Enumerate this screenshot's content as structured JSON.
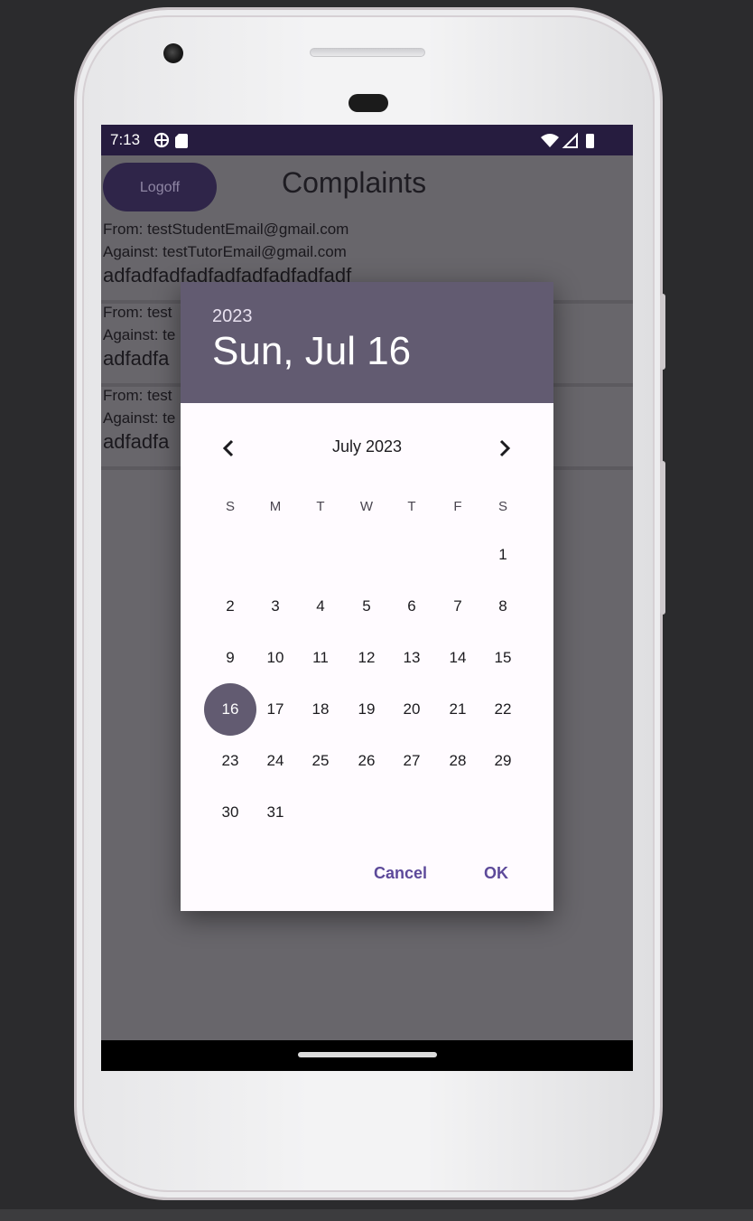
{
  "status_bar": {
    "time": "7:13"
  },
  "app": {
    "logoff_label": "Logoff",
    "title": "Complaints"
  },
  "complaints": [
    {
      "from": "From: testStudentEmail@gmail.com",
      "against": "Against: testTutorEmail@gmail.com",
      "body": "adfadfadfadfadfadfadfadfadf"
    },
    {
      "from": "From: test",
      "against": "Against: te",
      "body": "adfadfa"
    },
    {
      "from": "From: test",
      "against": "Against: te",
      "body": "adfadfa"
    }
  ],
  "date_picker": {
    "year": "2023",
    "selected_date": "Sun, Jul 16",
    "month_label": "July 2023",
    "weekdays": [
      "S",
      "M",
      "T",
      "W",
      "T",
      "F",
      "S"
    ],
    "first_weekday_index": 6,
    "days": [
      "1",
      "2",
      "3",
      "4",
      "5",
      "6",
      "7",
      "8",
      "9",
      "10",
      "11",
      "12",
      "13",
      "14",
      "15",
      "16",
      "17",
      "18",
      "19",
      "20",
      "21",
      "22",
      "23",
      "24",
      "25",
      "26",
      "27",
      "28",
      "29",
      "30",
      "31"
    ],
    "selected_day": "16",
    "cancel_label": "Cancel",
    "ok_label": "OK",
    "prev_icon": "chevron-left-icon",
    "next_icon": "chevron-right-icon"
  },
  "colors": {
    "status_bar": "#261c3f",
    "header": "#625b71",
    "accent": "#5d4a9a",
    "scrim": "#68666b"
  }
}
